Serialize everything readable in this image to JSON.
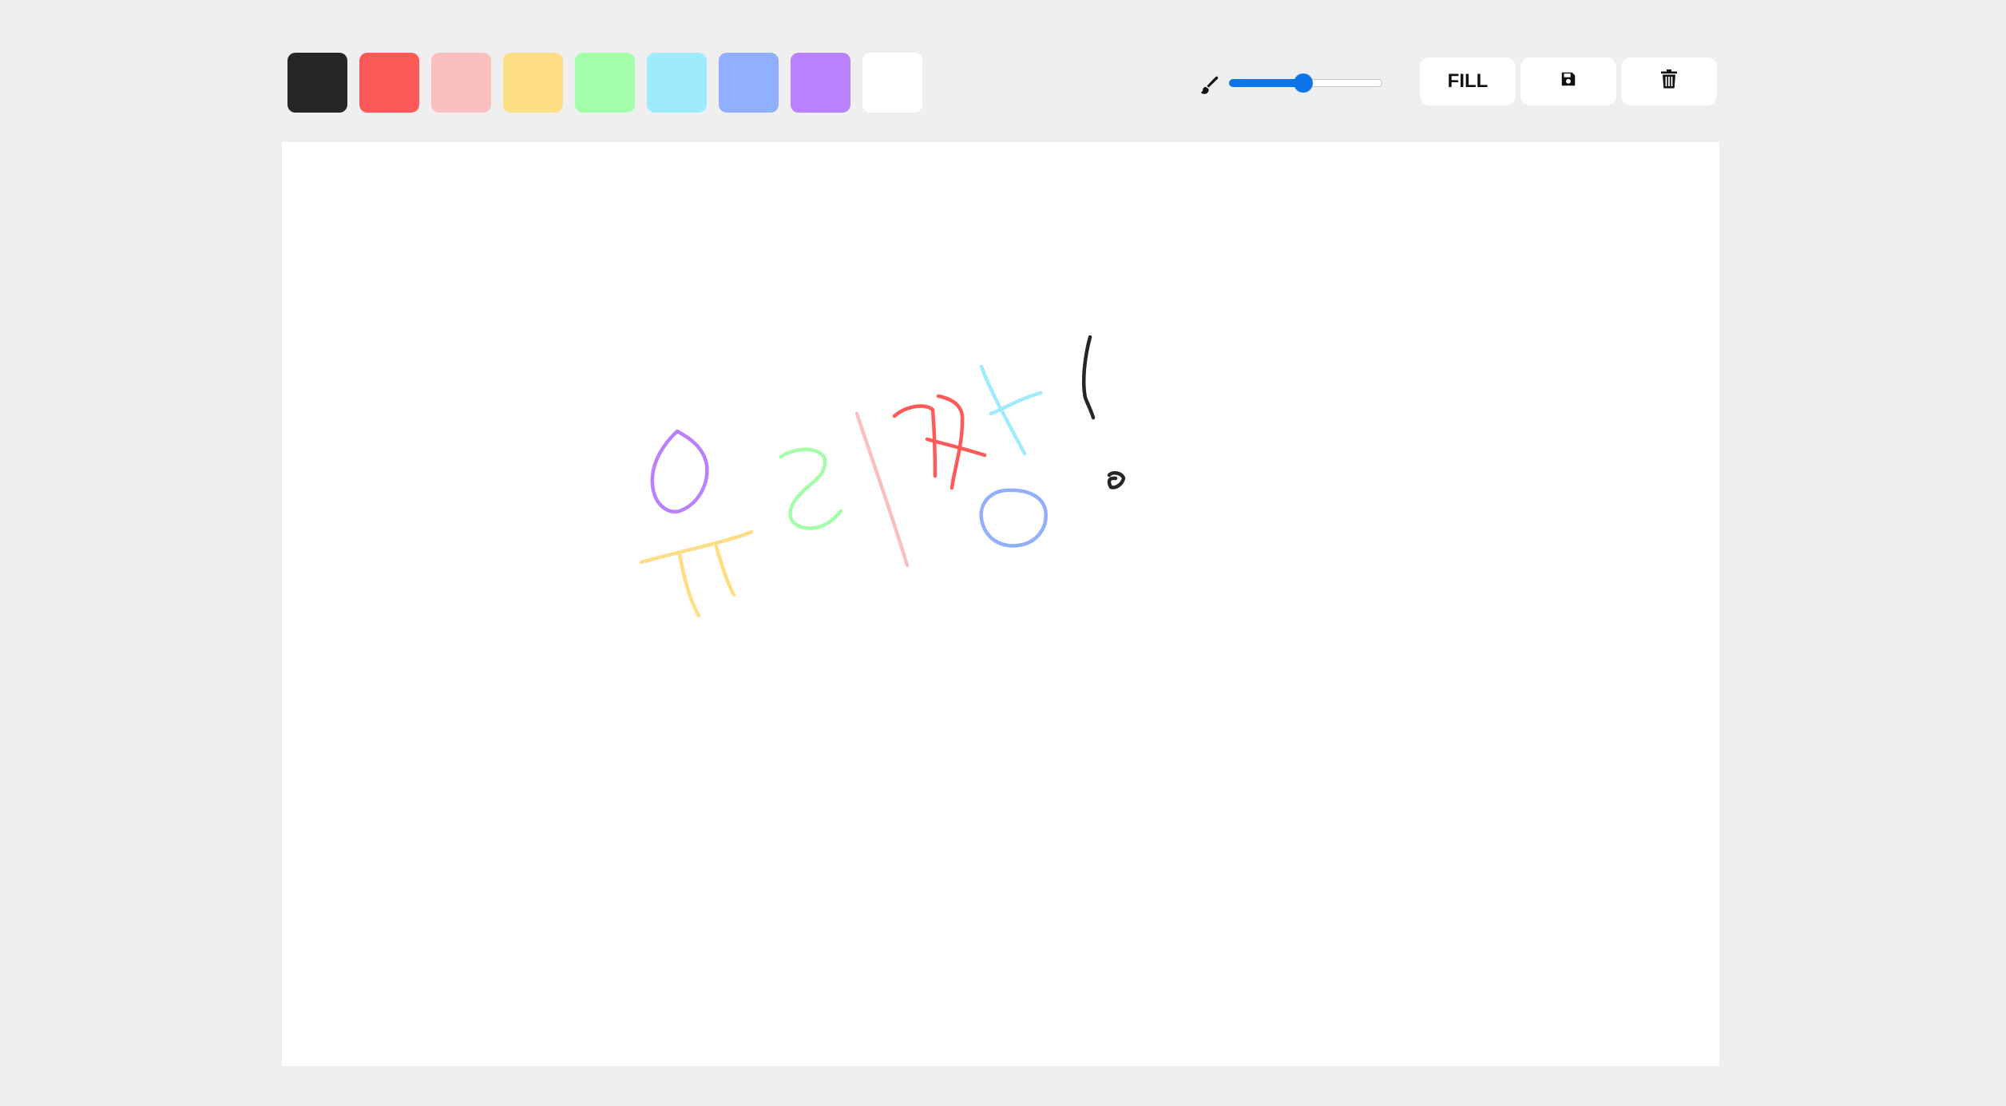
{
  "palette": [
    {
      "name": "black",
      "color": "#262626"
    },
    {
      "name": "red",
      "color": "#ff5a5a"
    },
    {
      "name": "pink",
      "color": "#fbbfbf"
    },
    {
      "name": "yellow",
      "color": "#fede84"
    },
    {
      "name": "green",
      "color": "#a3fea9"
    },
    {
      "name": "cyan",
      "color": "#9debfd"
    },
    {
      "name": "blue",
      "color": "#90affe"
    },
    {
      "name": "purple",
      "color": "#b981fd"
    },
    {
      "name": "white",
      "color": "#ffffff"
    }
  ],
  "brush": {
    "icon": "brush-icon",
    "size_fraction": 0.49,
    "accent_color": "#0a74e8"
  },
  "actions": {
    "fill_label": "FILL",
    "save_icon": "floppy-disk-icon",
    "clear_icon": "trash-icon"
  },
  "canvas": {
    "background": "#ffffff"
  }
}
